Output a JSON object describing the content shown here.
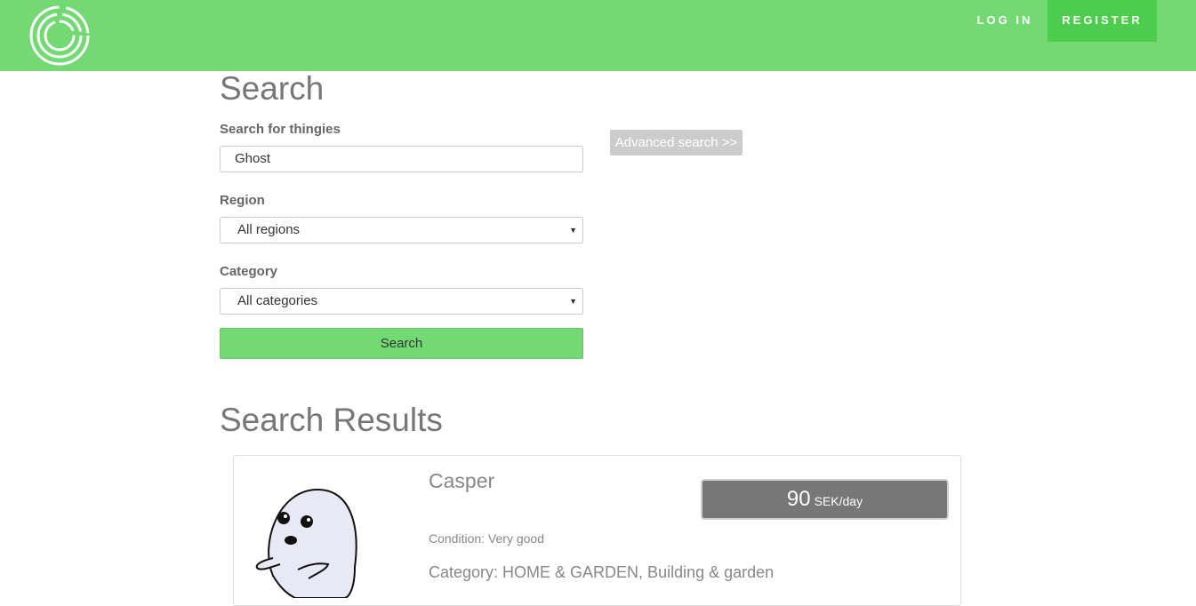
{
  "header": {
    "logo_icon": "concentric-circles-logo",
    "login_label": "LOG IN",
    "register_label": "REGISTER",
    "bar_color": "#73d973",
    "register_bg": "#4ccd4c"
  },
  "search": {
    "title": "Search",
    "query_label": "Search for thingies",
    "query_value": "Ghost",
    "region_label": "Region",
    "region_value": "All regions",
    "category_label": "Category",
    "category_value": "All categories",
    "search_button": "Search",
    "advanced_button": "Advanced search >>"
  },
  "results": {
    "title": "Search Results",
    "items": [
      {
        "image_icon": "ghost-illustration",
        "name": "Casper",
        "price": "90",
        "price_unit": "SEK/day",
        "condition": "Condition: Very good",
        "category": "Category: HOME & GARDEN, Building & garden"
      }
    ]
  }
}
